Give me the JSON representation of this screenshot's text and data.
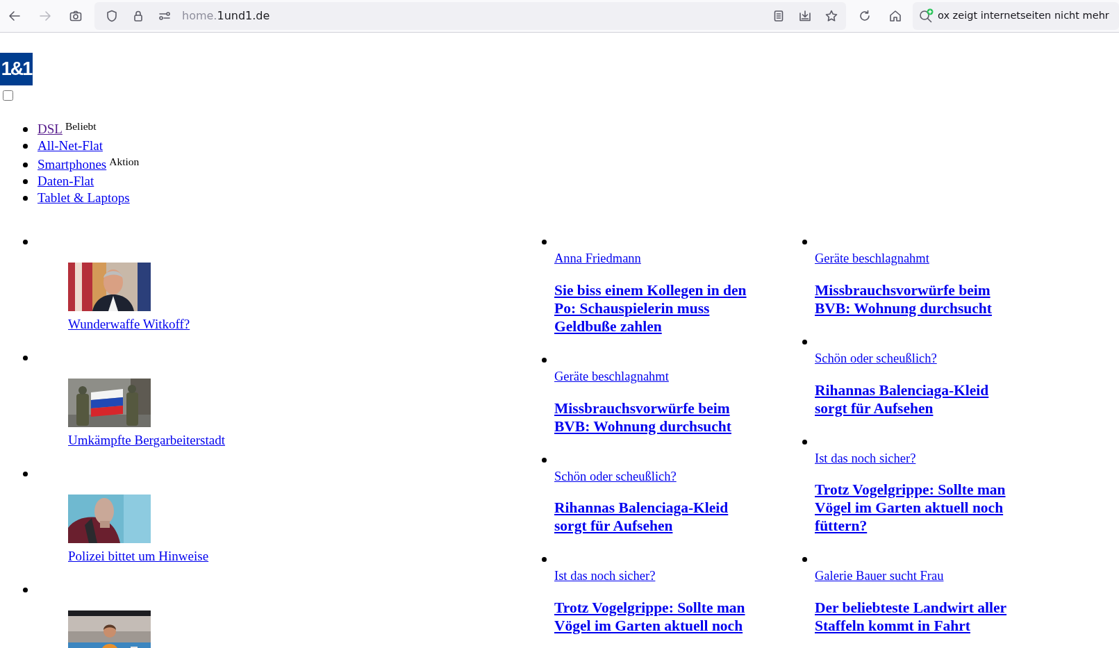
{
  "browser": {
    "nav_buttons": [
      {
        "kind": "back",
        "disabled": false
      },
      {
        "kind": "forward",
        "disabled": true
      }
    ],
    "url": {
      "host_prefix": "home.",
      "domain": "1und1.de"
    },
    "search_text": "ox zeigt internetseiten nicht mehr"
  },
  "logo": "1&1",
  "menu_toggle": {
    "checked": false
  },
  "nav": [
    {
      "label": "DSL",
      "visited": true,
      "tag": "Beliebt"
    },
    {
      "label": "All-Net-Flat",
      "visited": false
    },
    {
      "label": "Smartphones",
      "visited": false,
      "tag": "Aktion"
    },
    {
      "label": "Daten-Flat",
      "visited": false
    },
    {
      "label": "Tablet & Laptops",
      "visited": false
    }
  ],
  "teasers": [
    {
      "kind": "picture",
      "caption": "Wunderwaffe Witkoff?"
    },
    {
      "kind": "picture",
      "caption": "Umkämpfte Bergarbeiterstadt"
    },
    {
      "kind": "picture",
      "caption": "Polizei bittet um Hinweise"
    },
    {
      "kind": "picture"
    }
  ],
  "columns": [
    [
      {
        "kicker": "Anna Friedmann",
        "headline": "Sie biss einem Kollegen in den Po: Schauspielerin muss Geldbuße zahlen"
      },
      {
        "kicker": "Geräte beschlagnahmt",
        "headline": "Missbrauchsvorwürfe beim BVB: Wohnung durchsucht"
      },
      {
        "kicker": "Schön oder scheußlich?",
        "headline": "Rihannas Balenciaga-Kleid sorgt für Aufsehen"
      },
      {
        "kicker": "Ist das noch sicher?",
        "headline": "Trotz Vogelgrippe: Sollte man Vögel im Garten aktuell noch"
      }
    ],
    [
      {
        "kicker": "Geräte beschlagnahmt",
        "headline": "Missbrauchsvorwürfe beim BVB: Wohnung durchsucht"
      },
      {
        "kicker": "Schön oder scheußlich?",
        "headline": "Rihannas Balenciaga-Kleid sorgt für Aufsehen"
      },
      {
        "kicker": "Ist das noch sicher?",
        "headline": "Trotz Vogelgrippe: Sollte man Vögel im Garten aktuell noch füttern?"
      },
      {
        "kicker": "Galerie Bauer sucht Frau",
        "headline": "Der beliebteste Landwirt aller Staffeln kommt in Fahrt"
      }
    ]
  ]
}
